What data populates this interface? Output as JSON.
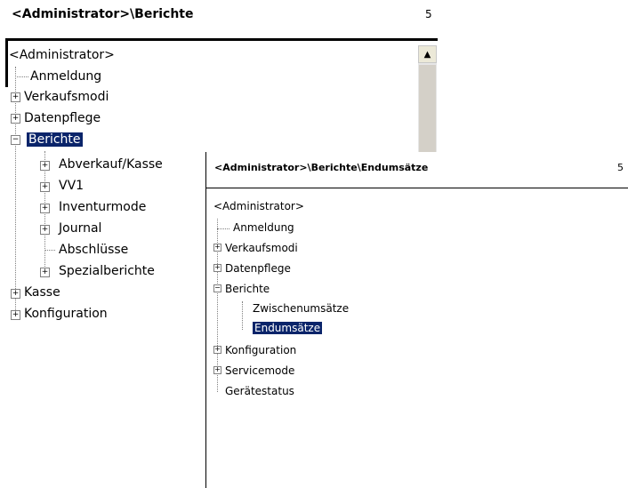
{
  "panel1": {
    "title": "<Administrator>\\Berichte",
    "page_number": "5",
    "tree": [
      {
        "label": "<Administrator>"
      },
      {
        "label": "Anmeldung"
      },
      {
        "label": "Verkaufsmodi",
        "expander": "+"
      },
      {
        "label": "Datenpflege",
        "expander": "+"
      },
      {
        "label": "Berichte",
        "expander": "−",
        "selected": true
      },
      {
        "label": "Abverkauf/Kasse",
        "expander": "+"
      },
      {
        "label": "VV1",
        "expander": "+"
      },
      {
        "label": "Inventurmode",
        "expander": "+"
      },
      {
        "label": "Journal",
        "expander": "+"
      },
      {
        "label": "Abschlüsse"
      },
      {
        "label": "Spezialberichte",
        "expander": "+"
      },
      {
        "label": "Kasse",
        "expander": "+"
      },
      {
        "label": "Konfiguration",
        "expander": "+"
      }
    ],
    "scroll_up_icon": "▲"
  },
  "panel2": {
    "title": "<Administrator>\\Berichte\\Endumsätze",
    "page_number": "5",
    "tree": [
      {
        "label": "<Administrator>"
      },
      {
        "label": "Anmeldung"
      },
      {
        "label": "Verkaufsmodi",
        "expander": "+"
      },
      {
        "label": "Datenpflege",
        "expander": "+"
      },
      {
        "label": "Berichte",
        "expander": "−"
      },
      {
        "label": "Zwischenumsätze"
      },
      {
        "label": "Endumsätze",
        "selected": true
      },
      {
        "label": "Konfiguration",
        "expander": "+"
      },
      {
        "label": "Servicemode",
        "expander": "+"
      },
      {
        "label": "Gerätestatus"
      }
    ]
  },
  "colors": {
    "selection": "#0a246a",
    "tree_lines": "#808080"
  }
}
